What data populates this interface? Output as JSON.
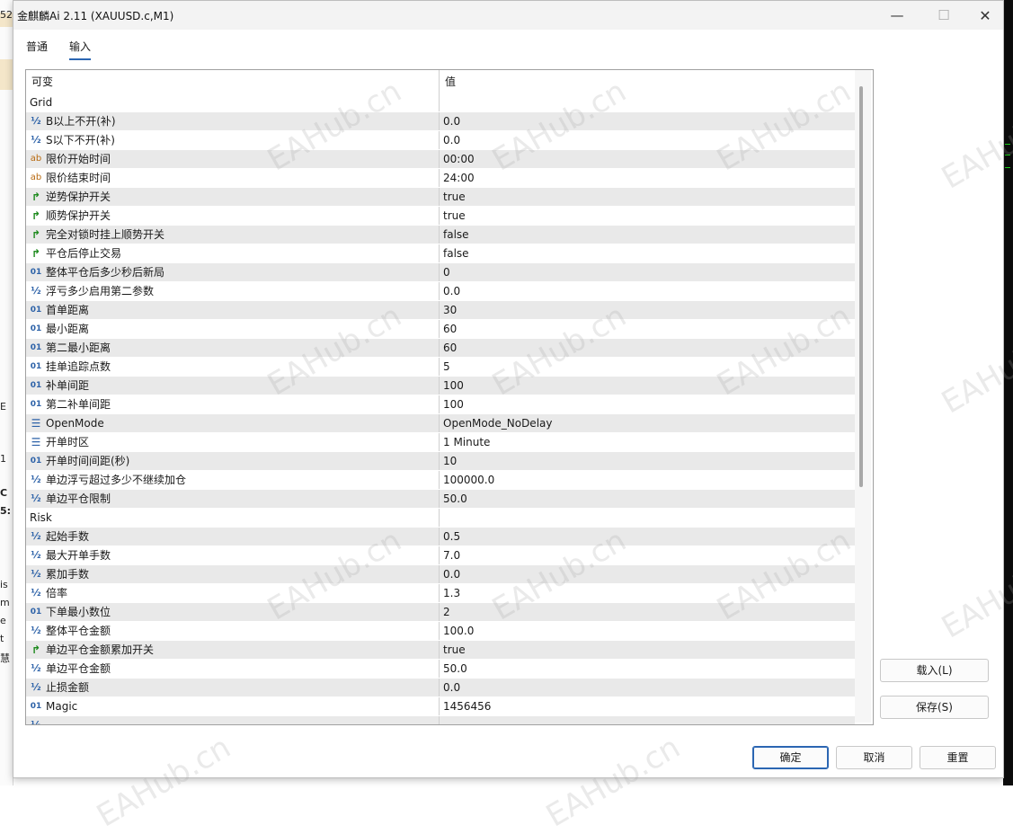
{
  "window": {
    "title": "金麒麟Ai 2.11 (XAUUSD.c,M1)",
    "minimize_glyph": "—",
    "maximize_glyph": "☐",
    "close_glyph": "✕"
  },
  "background": {
    "left_chars": [
      "52",
      "E",
      "1",
      "C",
      "5:",
      "is",
      "m",
      "e",
      "t",
      "慧"
    ]
  },
  "tabs": [
    {
      "label": "普通",
      "active": false
    },
    {
      "label": "输入",
      "active": true
    }
  ],
  "grid": {
    "headers": {
      "variable": "可变",
      "value": "值"
    },
    "rows": [
      {
        "type": "group",
        "name": "Grid",
        "value": ""
      },
      {
        "type": "param",
        "icon": "½",
        "icon_name": "fraction-icon",
        "name": "B以上不开(补)",
        "value": "0.0"
      },
      {
        "type": "param",
        "icon": "½",
        "icon_name": "fraction-icon",
        "name": "S以下不开(补)",
        "value": "0.0"
      },
      {
        "type": "param",
        "icon": "ab",
        "icon_name": "string-icon",
        "name": "限价开始时间",
        "value": "00:00"
      },
      {
        "type": "param",
        "icon": "ab",
        "icon_name": "string-icon",
        "name": "限价结束时间",
        "value": "24:00"
      },
      {
        "type": "param",
        "icon": "↱",
        "icon_name": "bool-icon",
        "name": "逆势保护开关",
        "value": "true"
      },
      {
        "type": "param",
        "icon": "↱",
        "icon_name": "bool-icon",
        "name": "顺势保护开关",
        "value": "true"
      },
      {
        "type": "param",
        "icon": "↱",
        "icon_name": "bool-icon",
        "name": "完全对锁时挂上顺势开关",
        "value": "false"
      },
      {
        "type": "param",
        "icon": "↱",
        "icon_name": "bool-icon",
        "name": "平仓后停止交易",
        "value": "false"
      },
      {
        "type": "param",
        "icon": "01",
        "icon_name": "integer-icon",
        "name": "整体平仓后多少秒后新局",
        "value": "0"
      },
      {
        "type": "param",
        "icon": "½",
        "icon_name": "fraction-icon",
        "name": "浮亏多少启用第二参数",
        "value": "0.0"
      },
      {
        "type": "param",
        "icon": "01",
        "icon_name": "integer-icon",
        "name": "首单距离",
        "value": "30"
      },
      {
        "type": "param",
        "icon": "01",
        "icon_name": "integer-icon",
        "name": "最小距离",
        "value": "60"
      },
      {
        "type": "param",
        "icon": "01",
        "icon_name": "integer-icon",
        "name": "第二最小距离",
        "value": "60"
      },
      {
        "type": "param",
        "icon": "01",
        "icon_name": "integer-icon",
        "name": "挂单追踪点数",
        "value": "5"
      },
      {
        "type": "param",
        "icon": "01",
        "icon_name": "integer-icon",
        "name": "补单间距",
        "value": "100"
      },
      {
        "type": "param",
        "icon": "01",
        "icon_name": "integer-icon",
        "name": "第二补单间距",
        "value": "100"
      },
      {
        "type": "param",
        "icon": "☰",
        "icon_name": "enum-icon",
        "name": "OpenMode",
        "value": "OpenMode_NoDelay"
      },
      {
        "type": "param",
        "icon": "☰",
        "icon_name": "enum-icon",
        "name": "开单时区",
        "value": "1 Minute"
      },
      {
        "type": "param",
        "icon": "01",
        "icon_name": "integer-icon",
        "name": "开单时间间距(秒)",
        "value": "10"
      },
      {
        "type": "param",
        "icon": "½",
        "icon_name": "fraction-icon",
        "name": "单边浮亏超过多少不继续加仓",
        "value": "100000.0"
      },
      {
        "type": "param",
        "icon": "½",
        "icon_name": "fraction-icon",
        "name": "单边平仓限制",
        "value": "50.0"
      },
      {
        "type": "group",
        "name": "Risk",
        "value": ""
      },
      {
        "type": "param",
        "icon": "½",
        "icon_name": "fraction-icon",
        "name": "起始手数",
        "value": "0.5"
      },
      {
        "type": "param",
        "icon": "½",
        "icon_name": "fraction-icon",
        "name": "最大开单手数",
        "value": "7.0"
      },
      {
        "type": "param",
        "icon": "½",
        "icon_name": "fraction-icon",
        "name": "累加手数",
        "value": "0.0"
      },
      {
        "type": "param",
        "icon": "½",
        "icon_name": "fraction-icon",
        "name": "倍率",
        "value": "1.3"
      },
      {
        "type": "param",
        "icon": "01",
        "icon_name": "integer-icon",
        "name": "下单最小数位",
        "value": "2"
      },
      {
        "type": "param",
        "icon": "½",
        "icon_name": "fraction-icon",
        "name": "整体平仓金额",
        "value": "100.0"
      },
      {
        "type": "param",
        "icon": "↱",
        "icon_name": "bool-icon",
        "name": "单边平仓金额累加开关",
        "value": "true"
      },
      {
        "type": "param",
        "icon": "½",
        "icon_name": "fraction-icon",
        "name": "单边平仓金额",
        "value": "50.0"
      },
      {
        "type": "param",
        "icon": "½",
        "icon_name": "fraction-icon",
        "name": "止损金额",
        "value": "0.0"
      },
      {
        "type": "param",
        "icon": "01",
        "icon_name": "integer-icon",
        "name": "Magic",
        "value": "1456456"
      },
      {
        "type": "param",
        "icon": "½",
        "icon_name": "fraction-icon",
        "name": "",
        "value": ""
      }
    ]
  },
  "buttons": {
    "load": "载入(L)",
    "save": "保存(S)",
    "ok": "确定",
    "cancel": "取消",
    "reset": "重置"
  },
  "watermark": "EAHub.cn",
  "colors": {
    "accent": "#2b66b2",
    "row_alt": "#e9e9e9",
    "bool_icon": "#1d8a1d",
    "string_icon": "#b86a10"
  }
}
